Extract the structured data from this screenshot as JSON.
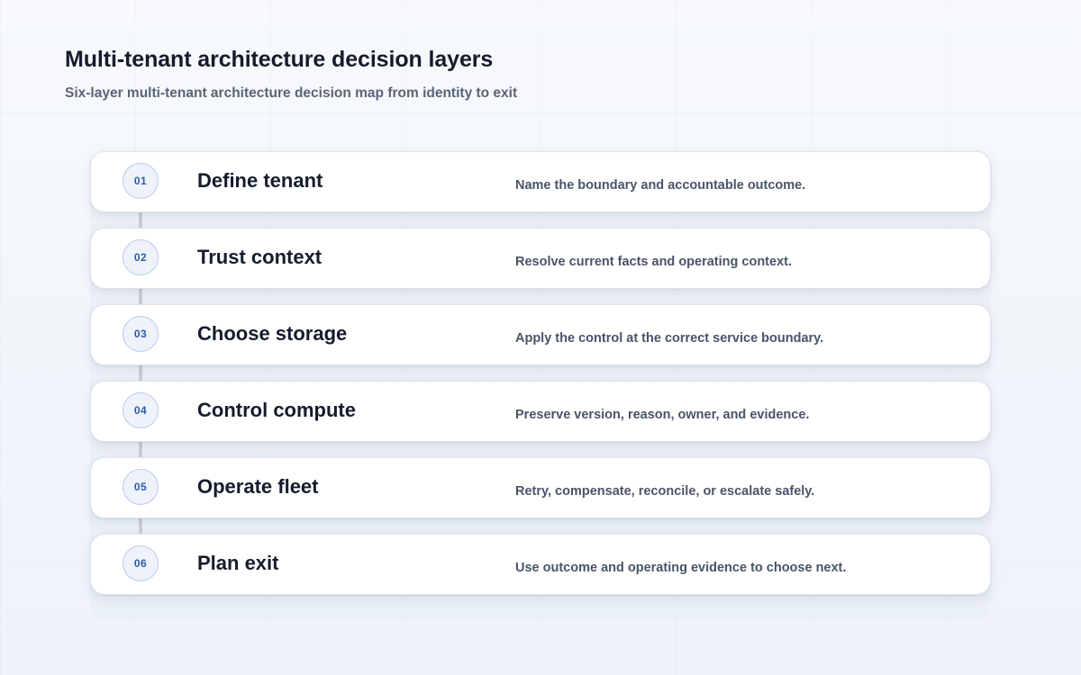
{
  "header": {
    "title": "Multi-tenant architecture decision layers",
    "subtitle": "Six-layer multi-tenant architecture decision map from identity to exit"
  },
  "layers": [
    {
      "number": "01",
      "name": "Define tenant",
      "description": "Name the boundary and accountable outcome."
    },
    {
      "number": "02",
      "name": "Trust context",
      "description": "Resolve current facts and operating context."
    },
    {
      "number": "03",
      "name": "Choose storage",
      "description": "Apply the control at the correct service boundary."
    },
    {
      "number": "04",
      "name": "Control compute",
      "description": "Preserve version, reason, owner, and evidence."
    },
    {
      "number": "05",
      "name": "Operate fleet",
      "description": "Retry, compensate, reconcile, or escalate safely."
    },
    {
      "number": "06",
      "name": "Plan exit",
      "description": "Use outcome and operating evidence to choose next."
    }
  ],
  "colors": {
    "badge_text": "#2f5aa8",
    "badge_border": "#b8cbea",
    "connector": "#c9ced8",
    "title": "#151c2c"
  }
}
